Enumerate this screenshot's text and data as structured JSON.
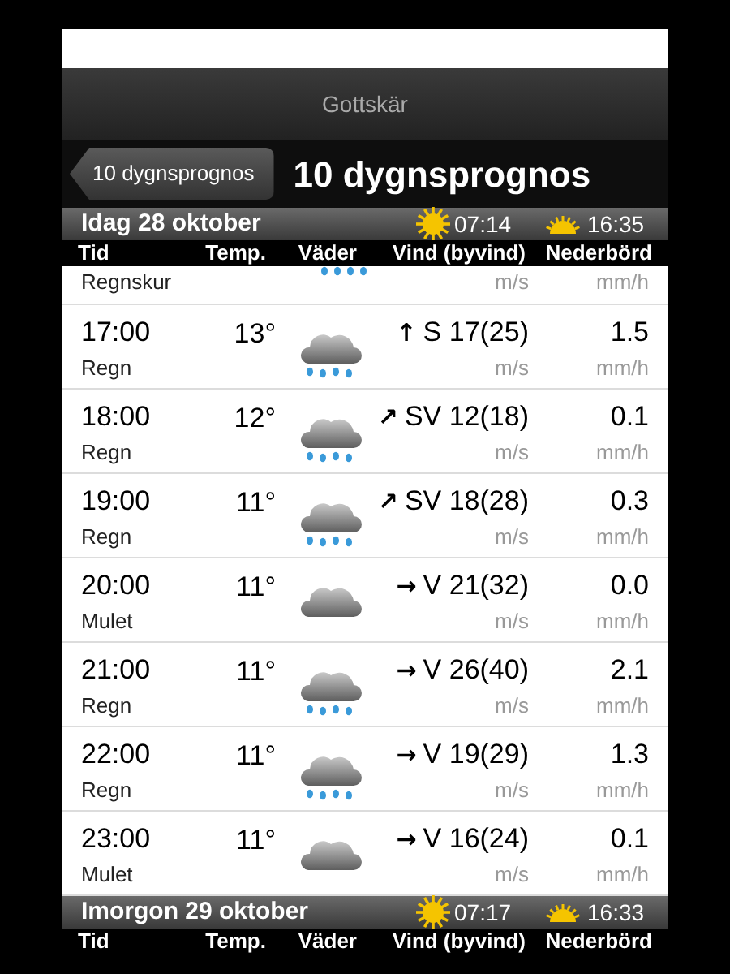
{
  "title_bar": {
    "title": "Gottskär"
  },
  "nav_bar": {
    "back_button": "10 dygnsprognos",
    "title": "10 dygnsprognos"
  },
  "days": [
    {
      "header": {
        "date": "Idag 28 oktober",
        "sunrise": "07:14",
        "sunset": "16:35"
      },
      "columns": [
        "Tid",
        "Temp.",
        "Väder",
        "Vind (byvind)",
        "Nederbörd"
      ],
      "rows": [
        {
          "kind": "cut",
          "description": "Regnskur",
          "weather_icon": {
            "kind": "shower"
          },
          "wind_unit": "m/s",
          "precip_unit": "mm/h"
        },
        {
          "kind": "full",
          "time": "17:00",
          "description": "Regn",
          "temp": "13°",
          "weather_icon": {
            "kind": "rain"
          },
          "wind_arrow": "↑",
          "wind": "S 17(25)",
          "wind_unit": "m/s",
          "precip": "1.5",
          "precip_unit": "mm/h"
        },
        {
          "kind": "full",
          "time": "18:00",
          "description": "Regn",
          "temp": "12°",
          "weather_icon": {
            "kind": "rain"
          },
          "wind_arrow": "↗",
          "wind": "SV 12(18)",
          "wind_unit": "m/s",
          "precip": "0.1",
          "precip_unit": "mm/h"
        },
        {
          "kind": "full",
          "time": "19:00",
          "description": "Regn",
          "temp": "11°",
          "weather_icon": {
            "kind": "rain"
          },
          "wind_arrow": "↗",
          "wind": "SV 18(28)",
          "wind_unit": "m/s",
          "precip": "0.3",
          "precip_unit": "mm/h"
        },
        {
          "kind": "full",
          "time": "20:00",
          "description": "Mulet",
          "temp": "11°",
          "weather_icon": {
            "kind": "cloud"
          },
          "wind_arrow": "→",
          "wind": "V 21(32)",
          "wind_unit": "m/s",
          "precip": "0.0",
          "precip_unit": "mm/h"
        },
        {
          "kind": "full",
          "time": "21:00",
          "description": "Regn",
          "temp": "11°",
          "weather_icon": {
            "kind": "rain"
          },
          "wind_arrow": "→",
          "wind": "V 26(40)",
          "wind_unit": "m/s",
          "precip": "2.1",
          "precip_unit": "mm/h"
        },
        {
          "kind": "full",
          "time": "22:00",
          "description": "Regn",
          "temp": "11°",
          "weather_icon": {
            "kind": "rain"
          },
          "wind_arrow": "→",
          "wind": "V 19(29)",
          "wind_unit": "m/s",
          "precip": "1.3",
          "precip_unit": "mm/h"
        },
        {
          "kind": "full",
          "time": "23:00",
          "description": "Mulet",
          "temp": "11°",
          "weather_icon": {
            "kind": "cloud"
          },
          "wind_arrow": "→",
          "wind": "V 16(24)",
          "wind_unit": "m/s",
          "precip": "0.1",
          "precip_unit": "mm/h"
        }
      ]
    },
    {
      "header": {
        "date": "Imorgon 29 oktober",
        "sunrise": "07:17",
        "sunset": "16:33"
      },
      "columns": [
        "Tid",
        "Temp.",
        "Väder",
        "Vind (byvind)",
        "Nederbörd"
      ]
    }
  ]
}
